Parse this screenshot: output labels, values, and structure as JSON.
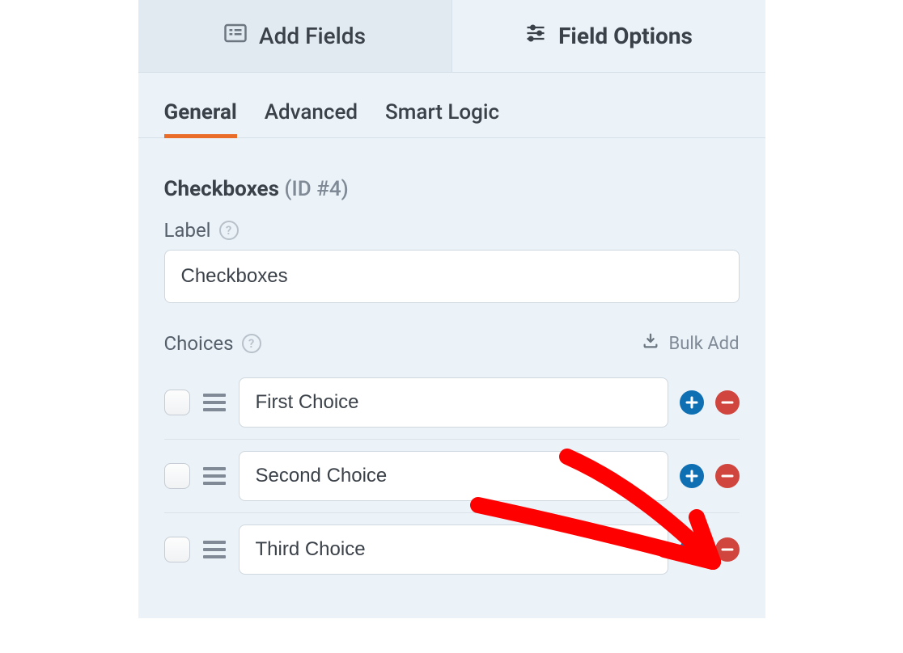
{
  "topTabs": {
    "addFields": "Add Fields",
    "fieldOptions": "Field Options"
  },
  "subTabs": {
    "general": "General",
    "advanced": "Advanced",
    "smartLogic": "Smart Logic"
  },
  "field": {
    "type": "Checkboxes",
    "idLabel": "(ID #4)"
  },
  "labelSection": {
    "label": "Label",
    "value": "Checkboxes"
  },
  "choicesSection": {
    "label": "Choices",
    "bulkAdd": "Bulk Add"
  },
  "choices": [
    {
      "value": "First Choice"
    },
    {
      "value": "Second Choice"
    },
    {
      "value": "Third Choice"
    }
  ],
  "colors": {
    "accent": "#e96d29",
    "addBtn": "#0f6fb3",
    "removeBtn": "#d0463e"
  }
}
